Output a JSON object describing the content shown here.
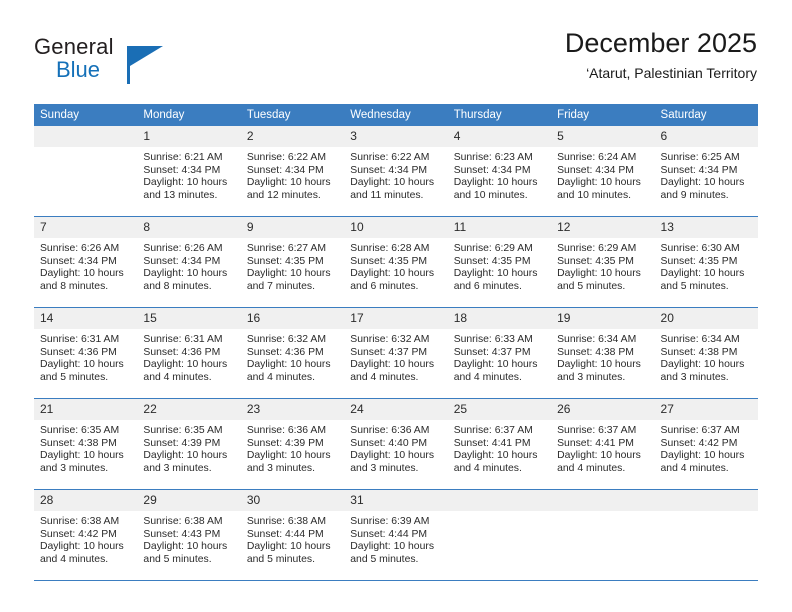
{
  "brand": {
    "name_part1": "General",
    "name_part2": "Blue",
    "logo_icon": "triangle-logo-icon"
  },
  "header": {
    "title": "December 2025",
    "location": "‘Atarut, Palestinian Territory"
  },
  "colors": {
    "header_blue": "#3b7dc0",
    "daynum_gray": "#f0f0f0",
    "brand_blue": "#1470b8",
    "text": "#2b2b2b"
  },
  "weekday_headers": [
    "Sunday",
    "Monday",
    "Tuesday",
    "Wednesday",
    "Thursday",
    "Friday",
    "Saturday"
  ],
  "weeks": [
    [
      {
        "day": "",
        "sunrise": "",
        "sunset": "",
        "daylight_line1": "",
        "daylight_line2": "",
        "empty": true
      },
      {
        "day": "1",
        "sunrise": "Sunrise: 6:21 AM",
        "sunset": "Sunset: 4:34 PM",
        "daylight_line1": "Daylight: 10 hours",
        "daylight_line2": "and 13 minutes."
      },
      {
        "day": "2",
        "sunrise": "Sunrise: 6:22 AM",
        "sunset": "Sunset: 4:34 PM",
        "daylight_line1": "Daylight: 10 hours",
        "daylight_line2": "and 12 minutes."
      },
      {
        "day": "3",
        "sunrise": "Sunrise: 6:22 AM",
        "sunset": "Sunset: 4:34 PM",
        "daylight_line1": "Daylight: 10 hours",
        "daylight_line2": "and 11 minutes."
      },
      {
        "day": "4",
        "sunrise": "Sunrise: 6:23 AM",
        "sunset": "Sunset: 4:34 PM",
        "daylight_line1": "Daylight: 10 hours",
        "daylight_line2": "and 10 minutes."
      },
      {
        "day": "5",
        "sunrise": "Sunrise: 6:24 AM",
        "sunset": "Sunset: 4:34 PM",
        "daylight_line1": "Daylight: 10 hours",
        "daylight_line2": "and 10 minutes."
      },
      {
        "day": "6",
        "sunrise": "Sunrise: 6:25 AM",
        "sunset": "Sunset: 4:34 PM",
        "daylight_line1": "Daylight: 10 hours",
        "daylight_line2": "and 9 minutes."
      }
    ],
    [
      {
        "day": "7",
        "sunrise": "Sunrise: 6:26 AM",
        "sunset": "Sunset: 4:34 PM",
        "daylight_line1": "Daylight: 10 hours",
        "daylight_line2": "and 8 minutes."
      },
      {
        "day": "8",
        "sunrise": "Sunrise: 6:26 AM",
        "sunset": "Sunset: 4:34 PM",
        "daylight_line1": "Daylight: 10 hours",
        "daylight_line2": "and 8 minutes."
      },
      {
        "day": "9",
        "sunrise": "Sunrise: 6:27 AM",
        "sunset": "Sunset: 4:35 PM",
        "daylight_line1": "Daylight: 10 hours",
        "daylight_line2": "and 7 minutes."
      },
      {
        "day": "10",
        "sunrise": "Sunrise: 6:28 AM",
        "sunset": "Sunset: 4:35 PM",
        "daylight_line1": "Daylight: 10 hours",
        "daylight_line2": "and 6 minutes."
      },
      {
        "day": "11",
        "sunrise": "Sunrise: 6:29 AM",
        "sunset": "Sunset: 4:35 PM",
        "daylight_line1": "Daylight: 10 hours",
        "daylight_line2": "and 6 minutes."
      },
      {
        "day": "12",
        "sunrise": "Sunrise: 6:29 AM",
        "sunset": "Sunset: 4:35 PM",
        "daylight_line1": "Daylight: 10 hours",
        "daylight_line2": "and 5 minutes."
      },
      {
        "day": "13",
        "sunrise": "Sunrise: 6:30 AM",
        "sunset": "Sunset: 4:35 PM",
        "daylight_line1": "Daylight: 10 hours",
        "daylight_line2": "and 5 minutes."
      }
    ],
    [
      {
        "day": "14",
        "sunrise": "Sunrise: 6:31 AM",
        "sunset": "Sunset: 4:36 PM",
        "daylight_line1": "Daylight: 10 hours",
        "daylight_line2": "and 5 minutes."
      },
      {
        "day": "15",
        "sunrise": "Sunrise: 6:31 AM",
        "sunset": "Sunset: 4:36 PM",
        "daylight_line1": "Daylight: 10 hours",
        "daylight_line2": "and 4 minutes."
      },
      {
        "day": "16",
        "sunrise": "Sunrise: 6:32 AM",
        "sunset": "Sunset: 4:36 PM",
        "daylight_line1": "Daylight: 10 hours",
        "daylight_line2": "and 4 minutes."
      },
      {
        "day": "17",
        "sunrise": "Sunrise: 6:32 AM",
        "sunset": "Sunset: 4:37 PM",
        "daylight_line1": "Daylight: 10 hours",
        "daylight_line2": "and 4 minutes."
      },
      {
        "day": "18",
        "sunrise": "Sunrise: 6:33 AM",
        "sunset": "Sunset: 4:37 PM",
        "daylight_line1": "Daylight: 10 hours",
        "daylight_line2": "and 4 minutes."
      },
      {
        "day": "19",
        "sunrise": "Sunrise: 6:34 AM",
        "sunset": "Sunset: 4:38 PM",
        "daylight_line1": "Daylight: 10 hours",
        "daylight_line2": "and 3 minutes."
      },
      {
        "day": "20",
        "sunrise": "Sunrise: 6:34 AM",
        "sunset": "Sunset: 4:38 PM",
        "daylight_line1": "Daylight: 10 hours",
        "daylight_line2": "and 3 minutes."
      }
    ],
    [
      {
        "day": "21",
        "sunrise": "Sunrise: 6:35 AM",
        "sunset": "Sunset: 4:38 PM",
        "daylight_line1": "Daylight: 10 hours",
        "daylight_line2": "and 3 minutes."
      },
      {
        "day": "22",
        "sunrise": "Sunrise: 6:35 AM",
        "sunset": "Sunset: 4:39 PM",
        "daylight_line1": "Daylight: 10 hours",
        "daylight_line2": "and 3 minutes."
      },
      {
        "day": "23",
        "sunrise": "Sunrise: 6:36 AM",
        "sunset": "Sunset: 4:39 PM",
        "daylight_line1": "Daylight: 10 hours",
        "daylight_line2": "and 3 minutes."
      },
      {
        "day": "24",
        "sunrise": "Sunrise: 6:36 AM",
        "sunset": "Sunset: 4:40 PM",
        "daylight_line1": "Daylight: 10 hours",
        "daylight_line2": "and 3 minutes."
      },
      {
        "day": "25",
        "sunrise": "Sunrise: 6:37 AM",
        "sunset": "Sunset: 4:41 PM",
        "daylight_line1": "Daylight: 10 hours",
        "daylight_line2": "and 4 minutes."
      },
      {
        "day": "26",
        "sunrise": "Sunrise: 6:37 AM",
        "sunset": "Sunset: 4:41 PM",
        "daylight_line1": "Daylight: 10 hours",
        "daylight_line2": "and 4 minutes."
      },
      {
        "day": "27",
        "sunrise": "Sunrise: 6:37 AM",
        "sunset": "Sunset: 4:42 PM",
        "daylight_line1": "Daylight: 10 hours",
        "daylight_line2": "and 4 minutes."
      }
    ],
    [
      {
        "day": "28",
        "sunrise": "Sunrise: 6:38 AM",
        "sunset": "Sunset: 4:42 PM",
        "daylight_line1": "Daylight: 10 hours",
        "daylight_line2": "and 4 minutes."
      },
      {
        "day": "29",
        "sunrise": "Sunrise: 6:38 AM",
        "sunset": "Sunset: 4:43 PM",
        "daylight_line1": "Daylight: 10 hours",
        "daylight_line2": "and 5 minutes."
      },
      {
        "day": "30",
        "sunrise": "Sunrise: 6:38 AM",
        "sunset": "Sunset: 4:44 PM",
        "daylight_line1": "Daylight: 10 hours",
        "daylight_line2": "and 5 minutes."
      },
      {
        "day": "31",
        "sunrise": "Sunrise: 6:39 AM",
        "sunset": "Sunset: 4:44 PM",
        "daylight_line1": "Daylight: 10 hours",
        "daylight_line2": "and 5 minutes."
      },
      {
        "day": "",
        "sunrise": "",
        "sunset": "",
        "daylight_line1": "",
        "daylight_line2": "",
        "empty": true
      },
      {
        "day": "",
        "sunrise": "",
        "sunset": "",
        "daylight_line1": "",
        "daylight_line2": "",
        "empty": true
      },
      {
        "day": "",
        "sunrise": "",
        "sunset": "",
        "daylight_line1": "",
        "daylight_line2": "",
        "empty": true
      }
    ]
  ]
}
